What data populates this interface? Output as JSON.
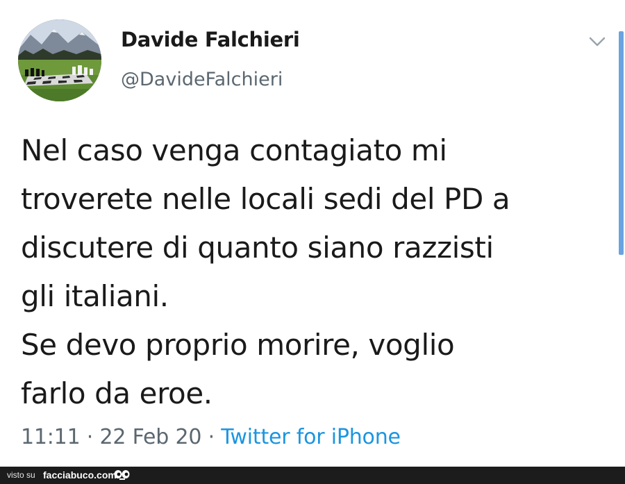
{
  "tweet": {
    "author": {
      "display_name": "Davide Falchieri",
      "handle": "@DavideFalchieri"
    },
    "text_lines": [
      "Nel caso venga contagiato mi",
      "troverete nelle locali sedi del PD a",
      "discutere di quanto siano razzisti",
      "gli italiani.",
      "Se devo proprio morire, voglio",
      "farlo da eroe."
    ],
    "meta": {
      "time": "11:11",
      "separator": " · ",
      "date": "22 Feb 20",
      "source": "Twitter for iPhone"
    },
    "icons": {
      "menu": "chevron-down-icon",
      "avatar": "chess-landscape-avatar"
    }
  },
  "footer": {
    "prefix": "visto su",
    "brand": "facciabuco.com",
    "logo": "eyes-icon"
  },
  "colors": {
    "link": "#1b95e0",
    "muted": "#5b6770",
    "text": "#1a1a1a",
    "footer_bg": "#1c1c1c",
    "scroll_indicator": "#6aa3e0"
  }
}
